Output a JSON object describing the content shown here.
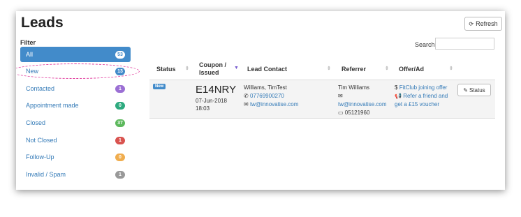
{
  "header": {
    "title": "Leads",
    "refresh_label": "Refresh"
  },
  "filter": {
    "label": "Filter",
    "items": [
      {
        "label": "All",
        "count": "53",
        "color": "#ffffff"
      },
      {
        "label": "New",
        "count": "13",
        "color": "#428bca"
      },
      {
        "label": "Contacted",
        "count": "1",
        "color": "#9b6fd4"
      },
      {
        "label": "Appointment made",
        "count": "0",
        "color": "#2eaa7f"
      },
      {
        "label": "Closed",
        "count": "37",
        "color": "#5cb85c"
      },
      {
        "label": "Not Closed",
        "count": "1",
        "color": "#d9534f"
      },
      {
        "label": "Follow-Up",
        "count": "0",
        "color": "#f0ad4e"
      },
      {
        "label": "Invalid / Spam",
        "count": "1",
        "color": "#999999"
      }
    ]
  },
  "search": {
    "label": "Search:",
    "value": ""
  },
  "table": {
    "headers": {
      "status": "Status",
      "coupon_l1": "Coupon /",
      "coupon_l2": "Issued",
      "contact": "Lead Contact",
      "referrer": "Referrer",
      "offer": "Offer/Ad"
    },
    "row": {
      "badge": "New",
      "coupon": "E14NRY",
      "date": "07-Jun-2018",
      "time": "18:03",
      "contact_name": "Williams, TimTest",
      "contact_phone": "07769900270",
      "contact_email": "tw@innovatise.com",
      "ref_name": "Tim Williams",
      "ref_email": "tw@innovatise.com",
      "ref_date": "05121960",
      "offer1": "FitClub joining offer",
      "offer2_l1": "Refer a friend and",
      "offer2_l2": "get a £15 voucher",
      "status_btn": "Status"
    }
  }
}
